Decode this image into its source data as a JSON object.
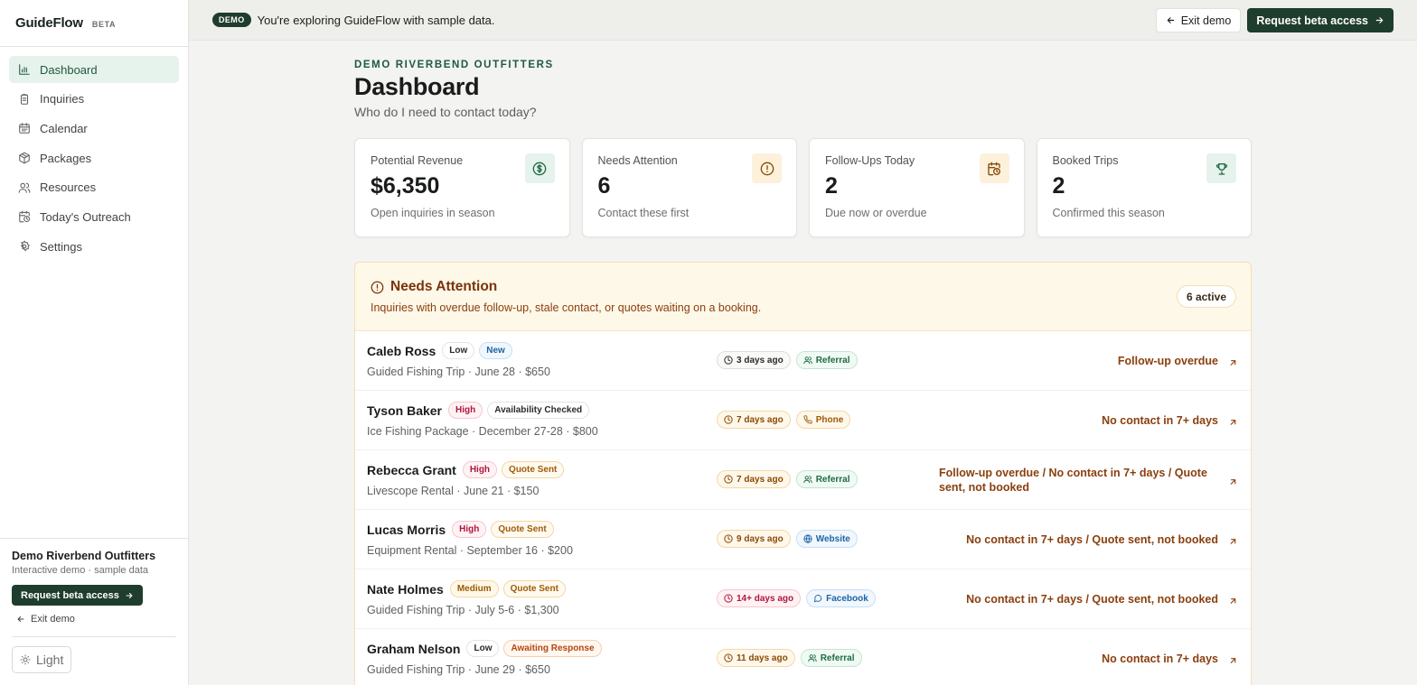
{
  "brand": {
    "name": "GuideFlow",
    "badge": "BETA"
  },
  "sidebar": {
    "items": [
      {
        "label": "Dashboard",
        "icon": "bar-chart-icon",
        "active": true
      },
      {
        "label": "Inquiries",
        "icon": "clipboard-icon"
      },
      {
        "label": "Calendar",
        "icon": "calendar-icon"
      },
      {
        "label": "Packages",
        "icon": "package-icon"
      },
      {
        "label": "Resources",
        "icon": "users-icon"
      },
      {
        "label": "Today's Outreach",
        "icon": "calendar-clock-icon"
      },
      {
        "label": "Settings",
        "icon": "gear-icon"
      }
    ],
    "org_name": "Demo Riverbend Outfitters",
    "org_sub": "Interactive demo · sample data",
    "request_label": "Request beta access",
    "exit_label": "Exit demo",
    "theme_label": "Light"
  },
  "topbar": {
    "pill": "DEMO",
    "text": "You're exploring GuideFlow with sample data.",
    "exit_label": "Exit demo",
    "request_label": "Request beta access"
  },
  "header": {
    "eyebrow": "DEMO RIVERBEND OUTFITTERS",
    "title": "Dashboard",
    "subtitle": "Who do I need to contact today?"
  },
  "stats": [
    {
      "label": "Potential Revenue",
      "value": "$6,350",
      "sub": "Open inquiries in season",
      "icon": "dollar-circle-icon",
      "icon_bg": "#e6f2ec",
      "icon_color": "#1e6a43"
    },
    {
      "label": "Needs Attention",
      "value": "6",
      "sub": "Contact these first",
      "icon": "alert-circle-icon",
      "icon_bg": "#fdf1dc",
      "icon_color": "#8a4a05"
    },
    {
      "label": "Follow-Ups Today",
      "value": "2",
      "sub": "Due now or overdue",
      "icon": "calendar-clock-icon",
      "icon_bg": "#fdf1dc",
      "icon_color": "#8a4a05"
    },
    {
      "label": "Booked Trips",
      "value": "2",
      "sub": "Confirmed this season",
      "icon": "trophy-icon",
      "icon_bg": "#e6f2ec",
      "icon_color": "#1e6a43"
    }
  ],
  "attention": {
    "title": "Needs Attention",
    "subtitle": "Inquiries with overdue follow-up, stale contact, or quotes waiting on a booking.",
    "count_label": "6 active",
    "rows": [
      {
        "name": "Caleb Ross",
        "priority": "Low",
        "status": "New",
        "detail": "Guided Fishing Trip · June 28 · $650",
        "age": "3 days ago",
        "age_tone": "gray",
        "source": "Referral",
        "source_icon": "users-icon",
        "reason": "Follow-up overdue"
      },
      {
        "name": "Tyson Baker",
        "priority": "High",
        "status": "Availability Checked",
        "detail": "Ice Fishing Package · December 27-28 · $800",
        "age": "7 days ago",
        "age_tone": "amber",
        "source": "Phone",
        "source_icon": "phone-icon",
        "reason": "No contact in 7+ days"
      },
      {
        "name": "Rebecca Grant",
        "priority": "High",
        "status": "Quote Sent",
        "detail": "Livescope Rental · June 21 · $150",
        "age": "7 days ago",
        "age_tone": "amber",
        "source": "Referral",
        "source_icon": "users-icon",
        "reason": "Follow-up overdue / No contact in 7+ days / Quote sent, not booked"
      },
      {
        "name": "Lucas Morris",
        "priority": "High",
        "status": "Quote Sent",
        "detail": "Equipment Rental · September 16 · $200",
        "age": "9 days ago",
        "age_tone": "amber",
        "source": "Website",
        "source_icon": "globe-icon",
        "reason": "No contact in 7+ days / Quote sent, not booked"
      },
      {
        "name": "Nate Holmes",
        "priority": "Medium",
        "status": "Quote Sent",
        "detail": "Guided Fishing Trip · July 5-6 · $1,300",
        "age": "14+ days ago",
        "age_tone": "red",
        "source": "Facebook",
        "source_icon": "message-icon",
        "reason": "No contact in 7+ days / Quote sent, not booked"
      },
      {
        "name": "Graham Nelson",
        "priority": "Low",
        "status": "Awaiting Response",
        "detail": "Guided Fishing Trip · June 29 · $650",
        "age": "11 days ago",
        "age_tone": "amber",
        "source": "Referral",
        "source_icon": "users-icon",
        "reason": "No contact in 7+ days"
      }
    ]
  }
}
